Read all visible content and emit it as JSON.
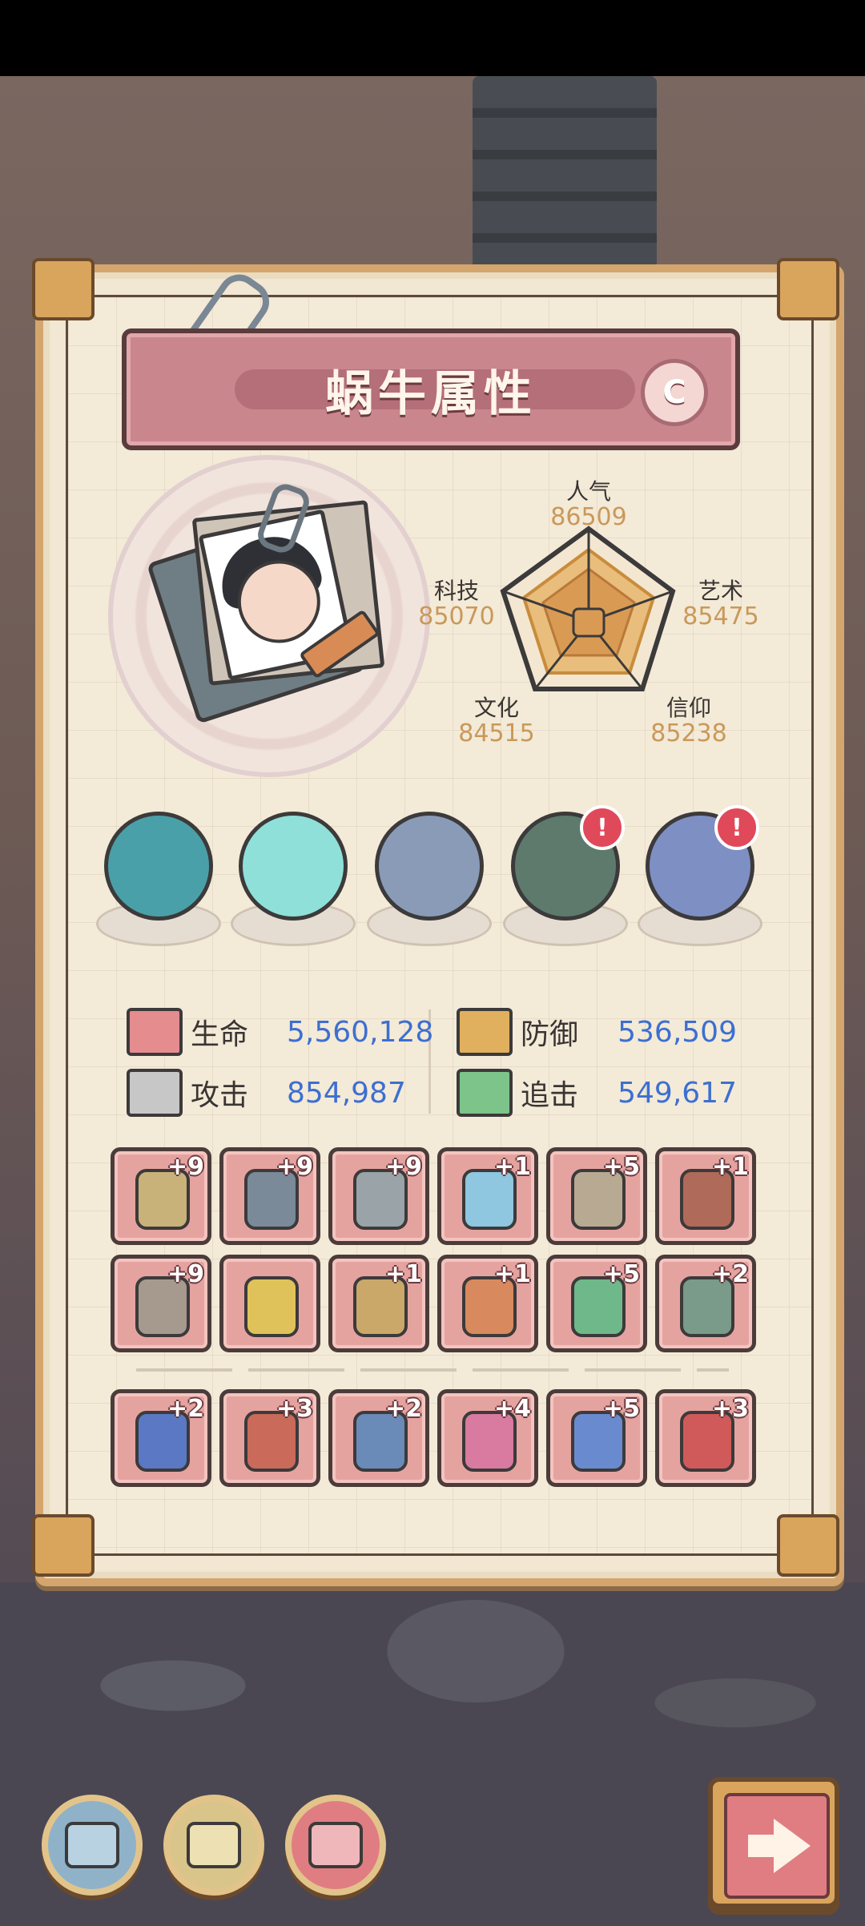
{
  "title": "蜗牛属性",
  "grade": "C",
  "radar": {
    "popularity": {
      "label": "人气",
      "value": "86509"
    },
    "art": {
      "label": "艺术",
      "value": "85475"
    },
    "faith": {
      "label": "信仰",
      "value": "85238"
    },
    "culture": {
      "label": "文化",
      "value": "84515"
    },
    "tech": {
      "label": "科技",
      "value": "85070"
    }
  },
  "relics": [
    {
      "icon": "sea-monster-relic-icon",
      "alert": false
    },
    {
      "icon": "crystal-shell-relic-icon",
      "alert": false
    },
    {
      "icon": "compass-relic-icon",
      "alert": false
    },
    {
      "icon": "green-orb-relic-icon",
      "alert": true
    },
    {
      "icon": "gem-relic-icon",
      "alert": true
    }
  ],
  "alert_mark": "!",
  "stats": {
    "hp": {
      "label": "生命",
      "value": "5,560,128"
    },
    "defense": {
      "label": "防御",
      "value": "536,509"
    },
    "attack": {
      "label": "攻击",
      "value": "854,987"
    },
    "chase": {
      "label": "追击",
      "value": "549,617"
    }
  },
  "gear_row1": [
    "+9",
    "+9",
    "+9",
    "+1",
    "+5",
    "+1"
  ],
  "gear_row2": [
    "+9",
    "",
    "+1",
    "+1",
    "+5",
    "+2"
  ],
  "gear_row3": [
    "+2",
    "+3",
    "+2",
    "+4",
    "+5",
    "+3"
  ],
  "colors": {
    "accent": "#c9868d",
    "stat_value": "#3d6fd0",
    "radar_value": "#c9995a"
  }
}
